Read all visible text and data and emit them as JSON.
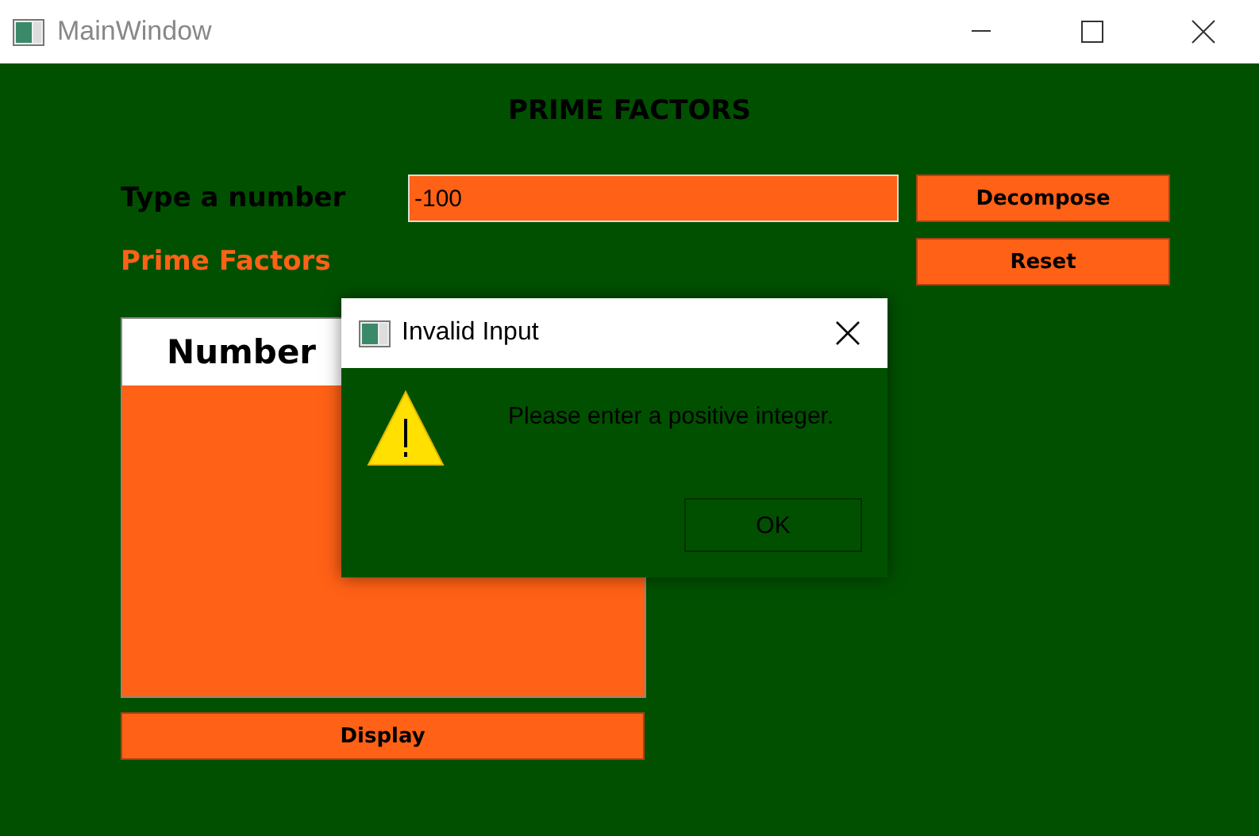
{
  "window": {
    "title": "MainWindow"
  },
  "heading": "PRIME FACTORS",
  "input": {
    "label": "Type a number",
    "value": "-100"
  },
  "buttons": {
    "decompose": "Decompose",
    "reset": "Reset",
    "display": "Display"
  },
  "results": {
    "label": "Prime Factors",
    "columns": [
      "Number"
    ]
  },
  "dialog": {
    "title": "Invalid Input",
    "message": "Please enter a positive integer.",
    "button": "OK"
  }
}
